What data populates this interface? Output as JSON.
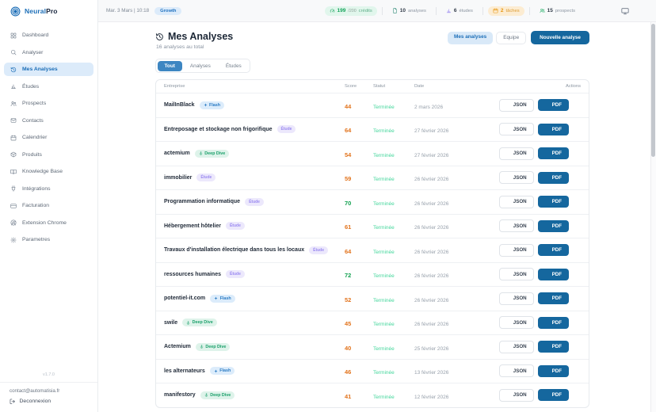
{
  "brand": {
    "logo_icon": "logo-icon",
    "name_blue": "Neural",
    "name_dark": "Pro"
  },
  "topbar": {
    "datetime": "Mar. 3 Mars | 10:18",
    "plan_badge": "Growth",
    "stats": [
      {
        "icon": "gauge-icon",
        "value": "199",
        "suffix": "/200",
        "label": "crédits",
        "pill": "pill-green",
        "icon_color": "#17a45c"
      },
      {
        "icon": "document-icon",
        "value": "10",
        "suffix": "",
        "label": "analyses",
        "pill": "",
        "icon_color": "#2c8a74"
      },
      {
        "icon": "chart-icon",
        "value": "6",
        "suffix": "",
        "label": "études",
        "pill": "",
        "icon_color": "#9b8af0"
      },
      {
        "icon": "calendar-icon",
        "value": "2",
        "suffix": "",
        "label": "tâches",
        "pill": "pill-orange",
        "icon_color": "#e8960f"
      },
      {
        "icon": "users-icon",
        "value": "15",
        "suffix": "",
        "label": "prospects",
        "pill": "",
        "icon_color": "#27b06a"
      }
    ],
    "monitor_icon": "monitor-icon"
  },
  "sidebar": {
    "items": [
      {
        "label": "Dashboard",
        "icon": "grid-icon",
        "active": false
      },
      {
        "label": "Analyser",
        "icon": "search-icon",
        "active": false
      },
      {
        "label": "Mes Analyses",
        "icon": "history-icon",
        "active": true
      },
      {
        "label": "Études",
        "icon": "chart-icon",
        "active": false
      },
      {
        "label": "Prospects",
        "icon": "users-icon",
        "active": false
      },
      {
        "label": "Contacts",
        "icon": "mail-icon",
        "active": false
      },
      {
        "label": "Calendrier",
        "icon": "calendar-icon",
        "active": false
      },
      {
        "label": "Produits",
        "icon": "package-icon",
        "active": false
      },
      {
        "label": "Knowledge Base",
        "icon": "book-icon",
        "active": false
      },
      {
        "label": "Intégrations",
        "icon": "plug-icon",
        "active": false
      },
      {
        "label": "Facturation",
        "icon": "card-icon",
        "active": false
      },
      {
        "label": "Extension Chrome",
        "icon": "chrome-icon",
        "active": false
      },
      {
        "label": "Parametres",
        "icon": "gear-icon",
        "active": false
      }
    ],
    "version": "v1.7.0",
    "contact_email": "contact@automatisia.fr",
    "logout_label": "Deconnexion"
  },
  "main": {
    "title": "Mes Analyses",
    "subtitle": "16 analyses au total",
    "view_toggle": [
      {
        "label": "Mes analyses",
        "active": true
      },
      {
        "label": "Equipe",
        "active": false
      }
    ],
    "new_analysis_label": "Nouvelle analyse",
    "filter_tabs": [
      {
        "label": "Tout",
        "active": true
      },
      {
        "label": "Analyses",
        "active": false
      },
      {
        "label": "Études",
        "active": false
      }
    ],
    "table": {
      "columns": {
        "company": "Entreprise",
        "score": "Score",
        "status": "Statut",
        "date": "Date",
        "actions": "Actions"
      },
      "action_labels": {
        "json": "JSON",
        "pdf": "PDF"
      },
      "rows": [
        {
          "name": "MailInBlack",
          "badge": "Flash",
          "badge_type": "flash",
          "score": "44",
          "score_color": "orange",
          "status": "Terminée",
          "date": "2 mars 2026"
        },
        {
          "name": "Entreposage et stockage non frigorifique",
          "badge": "Étude",
          "badge_type": "etude",
          "score": "64",
          "score_color": "orange",
          "status": "Terminée",
          "date": "27 février 2026"
        },
        {
          "name": "actemium",
          "badge": "Deep Dive",
          "badge_type": "deepdive",
          "score": "54",
          "score_color": "orange",
          "status": "Terminée",
          "date": "27 février 2026"
        },
        {
          "name": "immobilier",
          "badge": "Étude",
          "badge_type": "etude",
          "score": "59",
          "score_color": "orange",
          "status": "Terminée",
          "date": "26 février 2026"
        },
        {
          "name": "Programmation informatique",
          "badge": "Étude",
          "badge_type": "etude",
          "score": "70",
          "score_color": "green",
          "status": "Terminée",
          "date": "26 février 2026"
        },
        {
          "name": "Hébergement hôtelier",
          "badge": "Étude",
          "badge_type": "etude",
          "score": "61",
          "score_color": "orange",
          "status": "Terminée",
          "date": "26 février 2026"
        },
        {
          "name": "Travaux d'installation électrique dans tous les locaux",
          "badge": "Étude",
          "badge_type": "etude",
          "score": "64",
          "score_color": "orange",
          "status": "Terminée",
          "date": "26 février 2026"
        },
        {
          "name": "ressources humaines",
          "badge": "Étude",
          "badge_type": "etude",
          "score": "72",
          "score_color": "green",
          "status": "Terminée",
          "date": "26 février 2026"
        },
        {
          "name": "potentiel-it.com",
          "badge": "Flash",
          "badge_type": "flash",
          "score": "52",
          "score_color": "orange",
          "status": "Terminée",
          "date": "26 février 2026"
        },
        {
          "name": "swile",
          "badge": "Deep Dive",
          "badge_type": "deepdive",
          "score": "45",
          "score_color": "orange",
          "status": "Terminée",
          "date": "26 février 2026"
        },
        {
          "name": "Actemium",
          "badge": "Deep Dive",
          "badge_type": "deepdive",
          "score": "40",
          "score_color": "orange",
          "status": "Terminée",
          "date": "25 février 2026"
        },
        {
          "name": "les alternateurs",
          "badge": "Flash",
          "badge_type": "flash",
          "score": "46",
          "score_color": "orange",
          "status": "Terminée",
          "date": "13 février 2026"
        },
        {
          "name": "manifestory",
          "badge": "Deep Dive",
          "badge_type": "deepdive",
          "score": "41",
          "score_color": "orange",
          "status": "Terminée",
          "date": "12 février 2026"
        }
      ]
    }
  },
  "colors": {
    "primary_blue": "#15679e",
    "accent_blue": "#1d6fb8",
    "active_bg": "#dcebfa",
    "score_orange": "#e2731c",
    "score_green": "#12a150",
    "status_green": "#43d69b"
  }
}
